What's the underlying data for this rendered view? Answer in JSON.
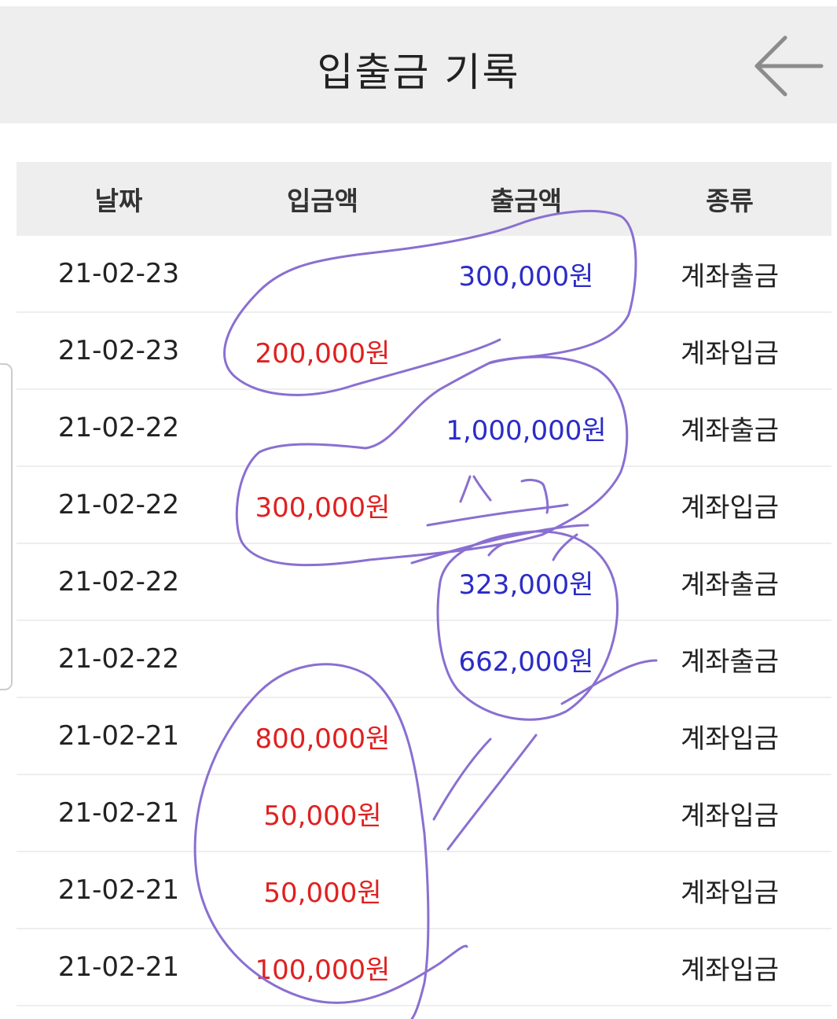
{
  "header": {
    "title": "입출금 기록",
    "back_icon": "arrow-left-icon"
  },
  "table": {
    "columns": [
      "날짜",
      "입금액",
      "출금액",
      "종류"
    ],
    "rows": [
      {
        "date": "21-02-23",
        "deposit": "",
        "withdrawal": "300,000원",
        "type": "계좌출금"
      },
      {
        "date": "21-02-23",
        "deposit": "200,000원",
        "withdrawal": "",
        "type": "계좌입금"
      },
      {
        "date": "21-02-22",
        "deposit": "",
        "withdrawal": "1,000,000원",
        "type": "계좌출금"
      },
      {
        "date": "21-02-22",
        "deposit": "300,000원",
        "withdrawal": "",
        "type": "계좌입금"
      },
      {
        "date": "21-02-22",
        "deposit": "",
        "withdrawal": "323,000원",
        "type": "계좌출금"
      },
      {
        "date": "21-02-22",
        "deposit": "",
        "withdrawal": "662,000원",
        "type": "계좌출금"
      },
      {
        "date": "21-02-21",
        "deposit": "800,000원",
        "withdrawal": "",
        "type": "계좌입금"
      },
      {
        "date": "21-02-21",
        "deposit": "50,000원",
        "withdrawal": "",
        "type": "계좌입금"
      },
      {
        "date": "21-02-21",
        "deposit": "50,000원",
        "withdrawal": "",
        "type": "계좌입금"
      },
      {
        "date": "21-02-21",
        "deposit": "100,000원",
        "withdrawal": "",
        "type": "계좌입금"
      }
    ]
  },
  "colors": {
    "deposit": "#e02020",
    "withdrawal": "#2b2bc8",
    "header_bg": "#eeeeee",
    "annotation": "#8a6fd1"
  }
}
